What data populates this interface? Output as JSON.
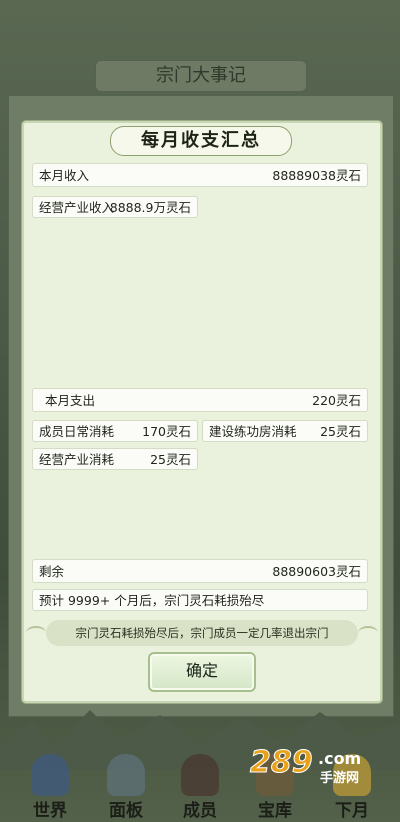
{
  "background": {
    "title": "宗门大事记",
    "nav": [
      {
        "label": "世界",
        "icon": "world-figure-icon"
      },
      {
        "label": "面板",
        "icon": "panel-figure-icon"
      },
      {
        "label": "成员",
        "icon": "member-figure-icon"
      },
      {
        "label": "宝库",
        "icon": "treasury-figure-icon"
      },
      {
        "label": "下月",
        "icon": "next-month-figure-icon"
      }
    ],
    "watermark": {
      "brand": "289",
      "suffix": ".com",
      "sub": "手游网"
    }
  },
  "dialog": {
    "title": "每月收支汇总",
    "income": {
      "label": "本月收入",
      "value": "88889038灵石",
      "items": [
        {
          "label": "经营产业收入",
          "value": "8888.9万灵石"
        }
      ]
    },
    "expense": {
      "label": "本月支出",
      "value": "220灵石",
      "items": [
        {
          "label": "成员日常消耗",
          "value": "170灵石"
        },
        {
          "label": "建设练功房消耗",
          "value": "25灵石"
        },
        {
          "label": "经营产业消耗",
          "value": "25灵石"
        }
      ]
    },
    "remaining": {
      "label": "剩余",
      "value": "88890603灵石"
    },
    "forecast": "预计 9999+ 个月后，宗门灵石耗损殆尽",
    "note": "宗门灵石耗损殆尽后，宗门成员一定几率退出宗门",
    "confirm": "确定"
  },
  "colors": {
    "dialog_bg": "#eaf1dc",
    "row_bg": "#fbfcf7",
    "accent_green": "#a7bf8e"
  }
}
